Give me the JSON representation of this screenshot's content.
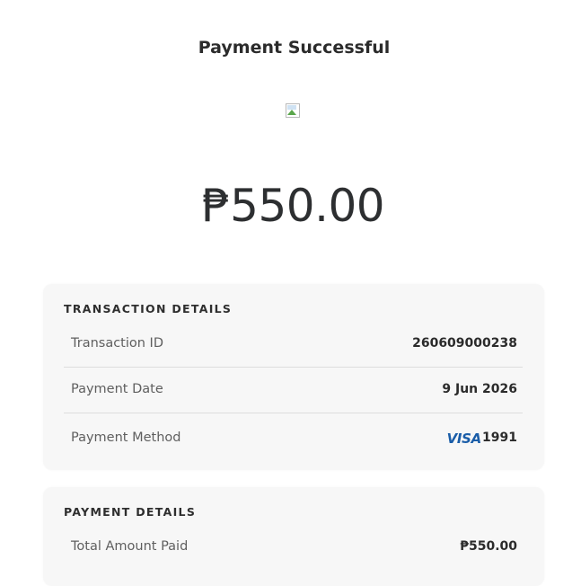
{
  "header": {
    "title": "Payment Successful"
  },
  "status_image": {
    "icon": "broken-image-icon"
  },
  "amount": {
    "display": "₱550.00"
  },
  "transaction_details": {
    "title": "TRANSACTION DETAILS",
    "rows": [
      {
        "label": "Transaction ID",
        "value": "260609000238"
      },
      {
        "label": "Payment Date",
        "value": "9 Jun 2026"
      },
      {
        "label": "Payment Method",
        "brand": "VISA",
        "value": "1991"
      }
    ]
  },
  "payment_details": {
    "title": "PAYMENT DETAILS",
    "rows": [
      {
        "label": "Total Amount Paid",
        "value": "₱550.00"
      }
    ]
  },
  "colors": {
    "card_background": "#f7f7f7",
    "visa_blue": "#1a5da8",
    "text_dark": "#2b2b2b",
    "text_label": "#5f5f5f"
  }
}
